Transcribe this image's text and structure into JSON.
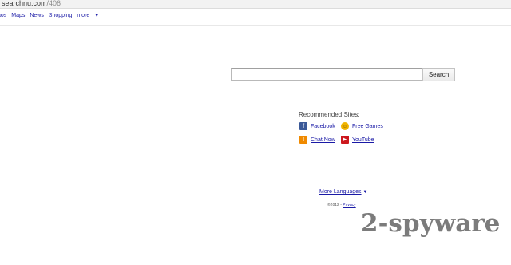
{
  "address_bar": {
    "host": "searchnu.com",
    "path": "/406"
  },
  "nav": {
    "items": [
      "aos",
      "Maps",
      "News",
      "Shopping"
    ],
    "more_label": "more",
    "more_caret": "▼"
  },
  "search": {
    "query": "",
    "button_label": "Search"
  },
  "recommended": {
    "title": "Recommended Sites:",
    "sites": [
      {
        "label": "Facebook",
        "icon": "facebook-icon",
        "color": "#3b5998"
      },
      {
        "label": "Free Games",
        "icon": "smiley-icon",
        "color": "#f0b400"
      },
      {
        "label": "Chat Now",
        "icon": "chat-icon",
        "color": "#f08a00"
      },
      {
        "label": "YouTube",
        "icon": "youtube-icon",
        "color": "#cc181e"
      }
    ]
  },
  "footer": {
    "more_languages": "More Languages",
    "caret": "▼",
    "copyright": "©2012 -",
    "privacy": "Privacy"
  },
  "watermark": "2-spyware"
}
